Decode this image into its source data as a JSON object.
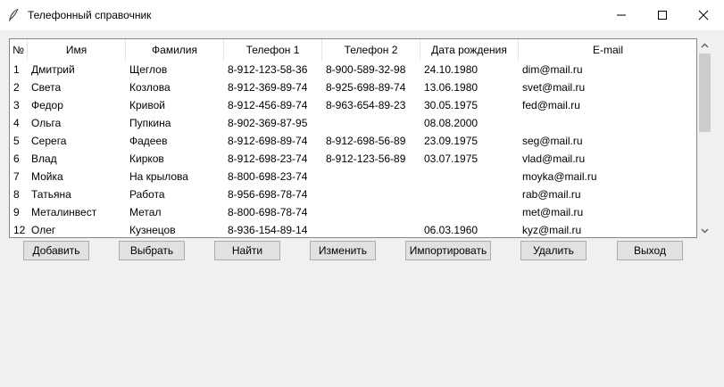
{
  "window": {
    "title": "Телефонный справочник"
  },
  "table": {
    "columns": [
      "№",
      "Имя",
      "Фамилия",
      "Телефон 1",
      "Телефон 2",
      "Дата рождения",
      "E-mail"
    ],
    "rows": [
      [
        "1",
        "Дмитрий",
        "Щеглов",
        "8-912-123-58-36",
        "8-900-589-32-98",
        "24.10.1980",
        "dim@mail.ru"
      ],
      [
        "2",
        "Света",
        "Козлова",
        "8-912-369-89-74",
        "8-925-698-89-74",
        "13.06.1980",
        "svet@mail.ru"
      ],
      [
        "3",
        "Федор",
        "Кривой",
        "8-912-456-89-74",
        "8-963-654-89-23",
        "30.05.1975",
        "fed@mail.ru"
      ],
      [
        "4",
        "Ольга",
        "Пупкина",
        "8-902-369-87-95",
        "",
        "08.08.2000",
        ""
      ],
      [
        "5",
        "Серега",
        "Фадеев",
        "8-912-698-89-74",
        "8-912-698-56-89",
        "23.09.1975",
        "seg@mail.ru"
      ],
      [
        "6",
        "Влад",
        "Кирков",
        "8-912-698-23-74",
        "8-912-123-56-89",
        "03.07.1975",
        "vlad@mail.ru"
      ],
      [
        "7",
        "Мойка",
        "На крылова",
        "8-800-698-23-74",
        "",
        "",
        "moyka@mail.ru"
      ],
      [
        "8",
        "Татьяна",
        "Работа",
        "8-956-698-78-74",
        "",
        "",
        "rab@mail.ru"
      ],
      [
        "9",
        "Металинвест",
        "Метал",
        "8-800-698-78-74",
        "",
        "",
        "met@mail.ru"
      ],
      [
        "12",
        "Олег",
        "Кузнецов",
        "8-936-154-89-14",
        "",
        "06.03.1960",
        "kyz@mail.ru"
      ]
    ]
  },
  "buttons": [
    "Добавить",
    "Выбрать",
    "Найти",
    "Изменить",
    "Импортировать",
    "Удалить",
    "Выход"
  ]
}
